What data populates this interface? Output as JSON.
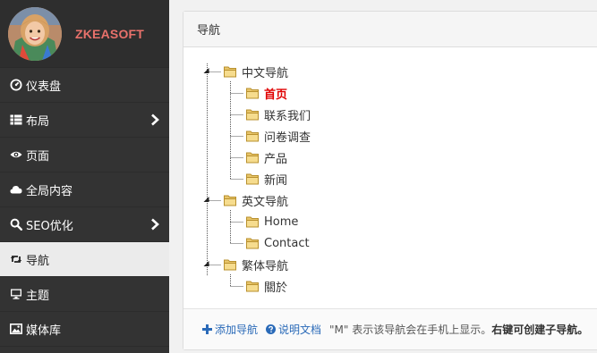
{
  "brand": {
    "name": "ZKEASOFT"
  },
  "sidebar": {
    "items": [
      {
        "label": "仪表盘",
        "icon": "dashboard-icon",
        "has_submenu": false,
        "active": false
      },
      {
        "label": "布局",
        "icon": "layout-grid-icon",
        "has_submenu": true,
        "active": false
      },
      {
        "label": "页面",
        "icon": "eye-icon",
        "has_submenu": false,
        "active": false
      },
      {
        "label": "全局内容",
        "icon": "cloud-icon",
        "has_submenu": false,
        "active": false
      },
      {
        "label": "SEO优化",
        "icon": "search-icon",
        "has_submenu": true,
        "active": false
      },
      {
        "label": "导航",
        "icon": "retweet-icon",
        "has_submenu": false,
        "active": true
      },
      {
        "label": "主题",
        "icon": "monitor-icon",
        "has_submenu": false,
        "active": false
      },
      {
        "label": "媒体库",
        "icon": "picture-icon",
        "has_submenu": false,
        "active": false
      }
    ]
  },
  "panel": {
    "title": "导航",
    "tree": [
      {
        "label": "中文导航",
        "children": [
          {
            "label": "首页",
            "current": true
          },
          {
            "label": "联系我们"
          },
          {
            "label": "问卷调查"
          },
          {
            "label": "产品"
          },
          {
            "label": "新闻"
          }
        ]
      },
      {
        "label": "英文导航",
        "children": [
          {
            "label": "Home"
          },
          {
            "label": "Contact"
          }
        ]
      },
      {
        "label": "繁体导航",
        "children": [
          {
            "label": "關於"
          }
        ]
      }
    ]
  },
  "footer": {
    "add_label": "添加导航",
    "help_label": "说明文档",
    "note": "\"M\" 表示该导航会在手机上显示。",
    "note_bold": "右键可创建子导航。"
  },
  "colors": {
    "sidebar_bg": "#333333",
    "brand_text": "#e8716b",
    "active_item_bg": "#ebebeb",
    "link": "#2a6ab8",
    "current_node": "#e00000"
  }
}
